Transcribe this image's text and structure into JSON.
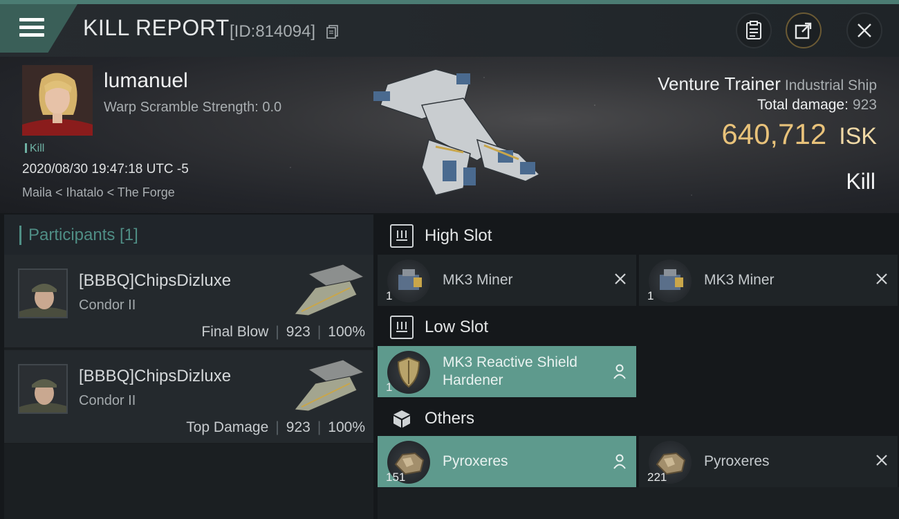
{
  "header": {
    "title": "KILL REPORT",
    "id_text": "[ID:814094]"
  },
  "victim": {
    "name": "lumanuel",
    "warp_scramble": "Warp Scramble Strength: 0.0",
    "kill_tag": "Kill",
    "datetime": "2020/08/30 19:47:18 UTC -5",
    "location": "Maila < Ihatalo < The Forge",
    "ship_name": "Venture Trainer",
    "ship_class": "Industrial Ship",
    "total_damage_label": "Total damage:",
    "total_damage": "923",
    "isk_value": "640,712",
    "isk_unit": "ISK",
    "result": "Kill"
  },
  "participants": {
    "title": "Participants [1]",
    "items": [
      {
        "name": "[BBBQ]ChipsDizluxe",
        "ship": "Condor II",
        "role": "Final Blow",
        "damage": "923",
        "percent": "100%"
      },
      {
        "name": "[BBBQ]ChipsDizluxe",
        "ship": "Condor II",
        "role": "Top Damage",
        "damage": "923",
        "percent": "100%"
      }
    ]
  },
  "slots": {
    "high": {
      "title": "High Slot",
      "items": [
        {
          "name": "MK3 Miner",
          "qty": "1",
          "status": "destroyed"
        },
        {
          "name": "MK3 Miner",
          "qty": "1",
          "status": "destroyed"
        }
      ]
    },
    "low": {
      "title": "Low Slot",
      "items": [
        {
          "name": "MK3 Reactive Shield Hardener",
          "qty": "1",
          "status": "dropped"
        }
      ]
    },
    "others": {
      "title": "Others",
      "items": [
        {
          "name": "Pyroxeres",
          "qty": "151",
          "status": "dropped"
        },
        {
          "name": "Pyroxeres",
          "qty": "221",
          "status": "destroyed"
        }
      ]
    }
  },
  "colors": {
    "accent": "#4f8e85",
    "dropped": "#5e9a8d",
    "isk": "#e8c27a"
  }
}
